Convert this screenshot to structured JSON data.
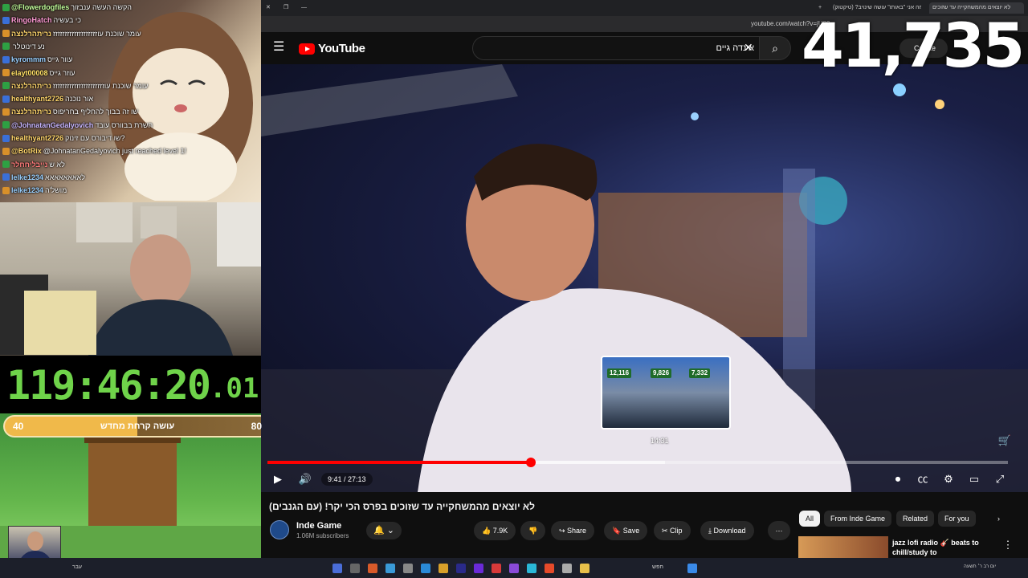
{
  "overlay": {
    "viewer_count": "41,735",
    "clock_main": "119:46:20",
    "clock_fraction": ".01",
    "xp_left": "40",
    "xp_label": "עושה קרחת מחדש",
    "xp_right": "80",
    "xp_progress": 0.5
  },
  "chat": [
    {
      "user": "@Flowerdogfiles",
      "text": "הקשה העשה ענבזוך",
      "color": "#c2ff9a"
    },
    {
      "user": "RingoHatch",
      "text": "כי בעשיה",
      "color": "#ff9ad4"
    },
    {
      "user": "נריתהרלנצה",
      "text": "עומר שוכנת עוזזזזזזזזזזזזזזזזזזז",
      "color": "#ffd66b"
    },
    {
      "user": "",
      "text": "נע דינוטלר",
      "color": "#ffffff"
    },
    {
      "user": "kyrommm",
      "text": "עוור גייס",
      "color": "#9ad0ff"
    },
    {
      "user": "elayt00008",
      "text": "עוזר גייס",
      "color": "#ffe066"
    },
    {
      "user": "נריתהרלנצה",
      "text": "עומר שוכנת עוזזזזזזזזזזזזזזזזזזזזזז",
      "color": "#ffd66b"
    },
    {
      "user": "healthyant2726",
      "text": "אור נוכנה",
      "color": "#ffd66b"
    },
    {
      "user": "נריתהרלנצה",
      "text": "שו זה בבוך להחליף בחריפוס",
      "color": "#ffd66b"
    },
    {
      "user": "@JohnatanGedalyovich",
      "text": "השרת בבוורס עובד",
      "color": "#c8b6ff"
    },
    {
      "user": "healthyant2726",
      "text": "שו דיבורס עם זינוק?",
      "color": "#ffd66b"
    },
    {
      "user": "@BotRix",
      "text": "@JohnatanGedalyovich just reached level 1!",
      "color": "#ffd66b"
    },
    {
      "user": "נייבליחחלר",
      "text": "לא ש",
      "color": "#ff7a7a"
    },
    {
      "user": "lelke1234",
      "text": "לאאאאאאאא",
      "color": "#9ad0ff"
    },
    {
      "user": "lelke1234",
      "text": "מושל'ה",
      "color": "#9ad0ff"
    }
  ],
  "browser": {
    "tabs": [
      "לא יוצאים מהמשחקייה עד שזוכים",
      "למה אני \"באותו\" עושה שינויב? (טיקטוק)"
    ],
    "url": "youtube.com/watch?v=jU82..."
  },
  "youtube": {
    "logo_text": "YouTube",
    "search_value": "אינדה גיים",
    "create_label": "Create",
    "time_display": "9:41 / 27:13",
    "progress_fraction": 0.356,
    "hover_time": "14:31",
    "thumb_scores": [
      "12,116",
      "9,826",
      "7,332"
    ],
    "video_title": "לא יוצאים מהמשחקייה עד שזוכים בפרס הכי יקר! (עם הגנבים)",
    "channel_name": "Inde Game",
    "channel_subs": "1.06M subscribers",
    "likes": "7.9K",
    "share_label": "Share",
    "save_label": "Save",
    "clip_label": "Clip",
    "download_label": "Download",
    "chips": [
      "All",
      "From Inde Game",
      "Related",
      "For you"
    ],
    "recommendation_title": "jazz lofi radio 🎸 beats to chill/study to"
  },
  "taskbar": {
    "left_text": "עבר",
    "search_label": "חפש",
    "clock_text": "יום רב ר׳ תשעה"
  }
}
